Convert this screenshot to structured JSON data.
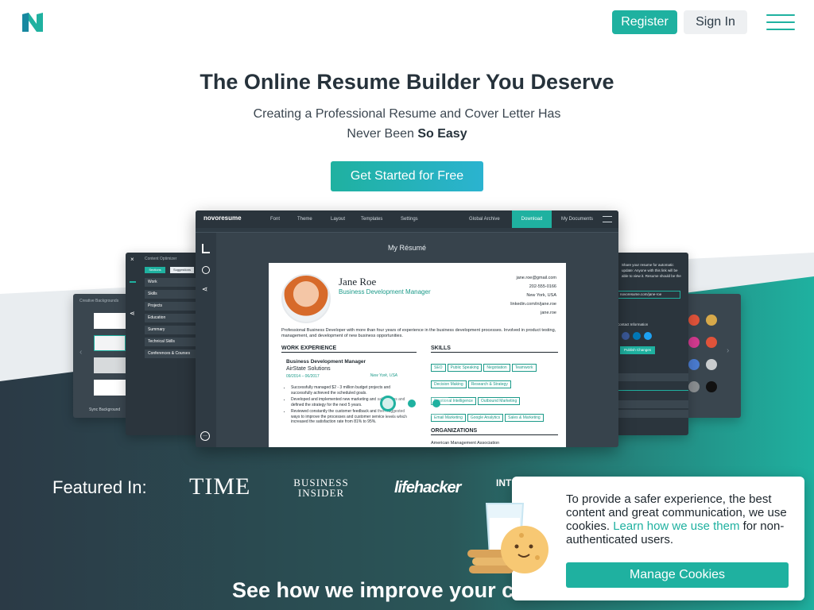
{
  "colors": {
    "accent": "#1fb1a0",
    "dark": "#2b3a46",
    "cta_gradient_end": "#2bb3d0"
  },
  "header": {
    "logo_icon": "novoresume-n-logo",
    "register_label": "Register",
    "signin_label": "Sign In",
    "menu_icon": "hamburger-icon"
  },
  "hero": {
    "title": "The Online Resume Builder You Deserve",
    "subtitle_line1": "Creating a Professional Resume and Cover Letter Has",
    "subtitle_line2_pre": "Never Been ",
    "subtitle_line2_bold": "So Easy",
    "cta_label": "Get Started for Free"
  },
  "editor": {
    "brand": "novoresume",
    "toolbar": [
      "Font",
      "Theme",
      "Layout",
      "Templates",
      "Settings",
      "Global Archive"
    ],
    "download_label": "Download",
    "my_documents_label": "My Documents",
    "page_label": "My Résumé",
    "resume": {
      "name": "Jane Roe",
      "role": "Business Development Manager",
      "contact": [
        "jane.roe@gmail.com",
        "202-555-0166",
        "New York, USA",
        "linkedin.com/in/jane.roe",
        "jane.roe"
      ],
      "summary": "Professional Business Developer with more than four years of experience in the business development processes. Involved in product testing, management, and development of new business opportunities.",
      "work_heading": "WORK EXPERIENCE",
      "job_title": "Business Development Manager",
      "company": "AirState Solutions",
      "dates": "09/2014 – 06/2017",
      "location": "New York, USA",
      "bullets": [
        "Successfully managed $2 - 3 million budget projects and successfully achieved the scheduled goals.",
        "Developed and implemented new marketing and sales plans and defined the strategy for the next 5 years.",
        "Reviewed constantly the customer feedback and then suggested ways to improve the processes and customer service levels which increased the satisfaction rate from 81% to 95%."
      ],
      "skills_heading": "SKILLS",
      "skills": [
        "SEO",
        "Public Speaking",
        "Negotiation",
        "Teamwork",
        "Decision Making",
        "Research & Strategy",
        "Emotional Intelligence",
        "Outbound Marketing",
        "Email Marketing",
        "Google Analytics",
        "Sales & Marketing"
      ],
      "org_heading": "ORGANIZATIONS",
      "org_item": "American Management Association"
    },
    "side_left": {
      "header": "Content Optimizer",
      "tabs": [
        "Sections",
        "Suggestions"
      ],
      "items": [
        "Work",
        "Skills",
        "Projects",
        "Education",
        "Summary",
        "Technical Skills",
        "Conferences & Courses"
      ]
    },
    "side_far_left": {
      "header": "Creative Backgrounds",
      "sync_label": "Sync Background"
    },
    "side_right": {
      "text": "Share your resume for automatic update: Anyone with this link will be able to view it. Resume should be the PDF.",
      "link": "novoresume.com/jane-roe",
      "contact_label": "Contact Information",
      "publish_label": "Publish Changes"
    },
    "carousel_count": 3,
    "carousel_active_index": 0
  },
  "featured": {
    "label": "Featured In:",
    "publications": [
      "TIME",
      "BUSINESS INSIDER",
      "lifehacker",
      "INTERNATIONAL ENERGY"
    ]
  },
  "see_how": "See how we improve your cha",
  "cookie": {
    "text_pre": "To provide a safer experience, the best content and great communication, we use cookies. ",
    "link_text": "Learn how we use them",
    "text_post": " for non-authenticated users.",
    "button_label": "Manage Cookies",
    "illustration": "milk-and-cookies-icon"
  }
}
